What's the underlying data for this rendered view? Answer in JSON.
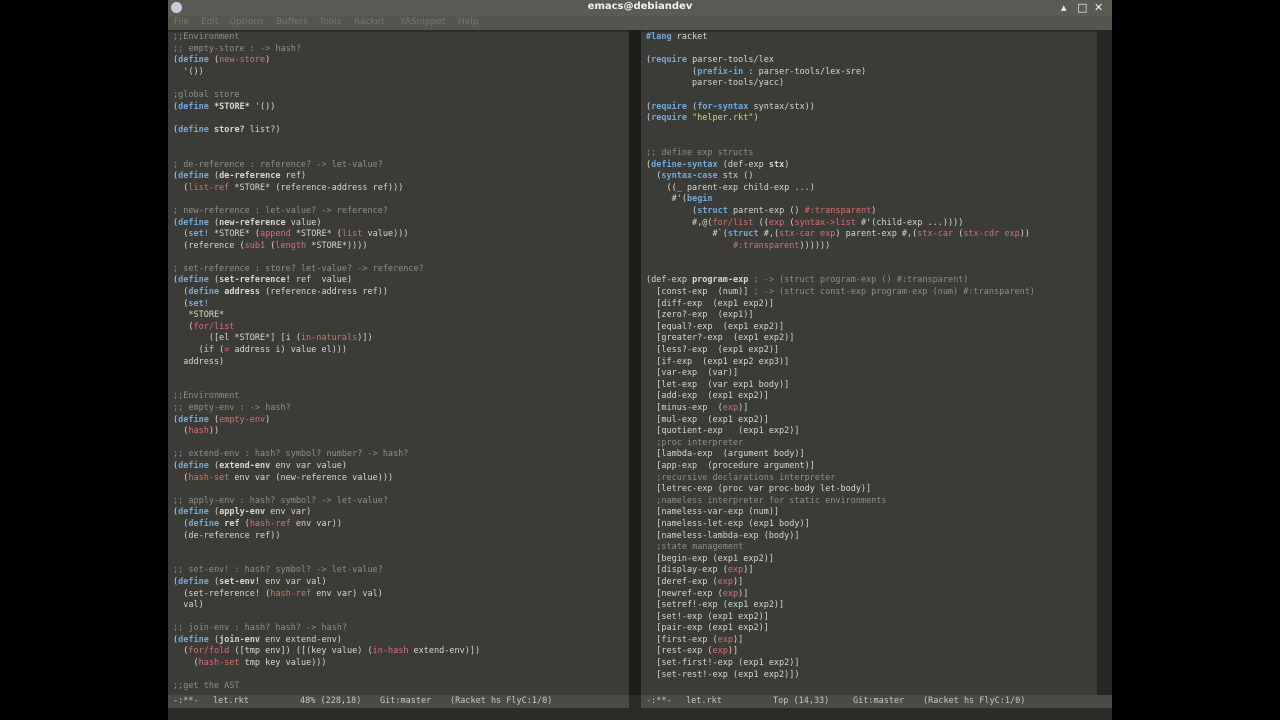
{
  "window": {
    "title": "emacs@debiandev"
  },
  "menu": [
    "File",
    "Edit",
    "Options",
    "Buffers",
    "Tools",
    "Racket",
    "YASnippet",
    "Help"
  ],
  "left_pane": {
    "lines": [
      ";;Environment",
      ";; empty-store : -> hash?",
      "(define (new-store)",
      "  '())",
      "",
      ";global store",
      "(define *STORE* '())",
      "",
      "(define store? list?)",
      "",
      "",
      "; de-reference : reference? -> let-value?",
      "(define (de-reference ref)",
      "  (list-ref *STORE* (reference-address ref)))",
      "",
      "; new-reference : let-value? -> reference?",
      "(define (new-reference value)",
      "  (set! *STORE* (append *STORE* (list value)))",
      "  (reference (sub1 (length *STORE*))))",
      "",
      "; set-reference : store? let-value? -> reference?",
      "(define (set-reference! ref  value)",
      "  (define address (reference-address ref))",
      "  (set!",
      "   *STORE*",
      "   (for/list",
      "       ([el *STORE*] [i (in-naturals)])",
      "     (if (= address i) value el)))",
      "  address)",
      "",
      "",
      ";;Environment",
      ";; empty-env : -> hash?",
      "(define (empty-env)",
      "  (hash))",
      "",
      ";; extend-env : hash? symbol? number? -> hash?",
      "(define (extend-env env var value)",
      "  (hash-set env var (new-reference value)))",
      "",
      ";; apply-env : hash? symbol? -> let-value?",
      "(define (apply-env env var)",
      "  (define ref (hash-ref env var))",
      "  (de-reference ref))",
      "",
      "",
      ";; set-env! : hash? symbol? -> let-value?",
      "(define (set-env! env var val)",
      "  (set-reference! (hash-ref env var) val)",
      "  val)",
      "",
      ";; join-env : hash? hash? -> hash?",
      "(define (join-env env extend-env)",
      "  (for/fold ([tmp env]) ([(key value) (in-hash extend-env)])",
      "    (hash-set tmp key value)))",
      "",
      ";;get the AST"
    ],
    "modeline": {
      "state": "-:**-",
      "buffer": "let.rkt",
      "position": "48% (228,18)",
      "vc": "Git:master",
      "modes": "(Racket hs FlyC:1/0)"
    }
  },
  "right_pane": {
    "lines": [
      "#lang racket",
      "",
      "(require parser-tools/lex",
      "         (prefix-in : parser-tools/lex-sre)",
      "         parser-tools/yacc)",
      "",
      "(require (for-syntax syntax/stx))",
      "(require \"helper.rkt\")",
      "",
      "",
      ";; define exp structs",
      "(define-syntax (def-exp stx)",
      "  (syntax-case stx ()",
      "    ((_ parent-exp child-exp ...)",
      "     #'(begin",
      "         (struct parent-exp () #:transparent)",
      "         #,@(for/list ((exp (syntax->list #'(child-exp ...))))",
      "             #`(struct #,(stx-car exp) parent-exp #,(stx-car (stx-cdr exp))",
      "                 #:transparent))))))",
      "",
      "",
      "(def-exp program-exp ; -> (struct program-exp () #:transparent)",
      "  [const-exp  (num)] ; -> (struct const-exp program-exp (num) #:transparent)",
      "  [diff-exp  (exp1 exp2)]",
      "  [zero?-exp  (exp1)]",
      "  [equal?-exp  (exp1 exp2)]",
      "  [greater?-exp  (exp1 exp2)]",
      "  [less?-exp  (exp1 exp2)]",
      "  [if-exp  (exp1 exp2 exp3)]",
      "  [var-exp  (var)]",
      "  [let-exp  (var exp1 body)]",
      "  [add-exp  (exp1 exp2)]",
      "  [minus-exp  (exp)]",
      "  [mul-exp  (exp1 exp2)]",
      "  [quotient-exp   (exp1 exp2)]",
      "  ;proc interpreter",
      "  [lambda-exp  (argument body)]",
      "  [app-exp  (procedure argument)]",
      "  ;recursive declarations interpreter",
      "  [letrec-exp (proc var proc-body let-body)]",
      "  ;nameless interpreter for static environments",
      "  [nameless-var-exp (num)]",
      "  [nameless-let-exp (exp1 body)]",
      "  [nameless-lambda-exp (body)]",
      "  ;state management",
      "  [begin-exp (exp1 exp2)]",
      "  [display-exp (exp)]",
      "  [deref-exp (exp)]",
      "  [newref-exp (exp)]",
      "  [setref!-exp (exp1 exp2)]",
      "  [set!-exp (exp1 exp2)]",
      "  [pair-exp (exp1 exp2)]",
      "  [first-exp (exp)]",
      "  [rest-exp (exp)]",
      "  [set-first!-exp (exp1 exp2)]",
      "  [set-rest!-exp (exp1 exp2)])"
    ],
    "modeline": {
      "state": "-:**-",
      "buffer": "let.rkt",
      "position": "Top (14,33)",
      "vc": "Git:master",
      "modes": "(Racket hs FlyC:1/0)"
    }
  },
  "colors": {
    "background": "#3b3b37",
    "text": "#d8d6cc",
    "comment": "#8f8f86",
    "keyword": "#74a8d8",
    "builtin": "#d87070",
    "string": "#c8d880"
  }
}
